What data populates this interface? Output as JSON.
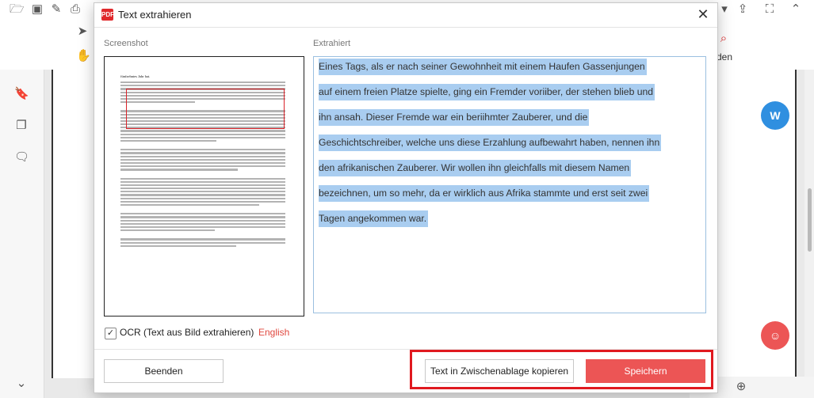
{
  "background_app": {
    "toolbar_fragment": "den",
    "fab_word_icon": "word-convert-icon",
    "fab_ai_icon": "ai-assistant-icon"
  },
  "dialog": {
    "title": "Text extrahieren",
    "close_icon": "close-icon",
    "screenshot_label": "Screenshot",
    "extracted_label": "Extrahiert",
    "screenshot_heading": "fünfzehntes Jahr hat.",
    "extracted_lines": [
      "Eines Tags, als er nach seiner Gewohnheit mit einem Haufen Gassenjungen",
      "auf einem freien Platze spielte, ging ein Fremder voriiber, der stehen blieb und",
      "ihn ansah. Dieser Fremde war ein beriihmter Zauberer, und die",
      "Geschichtschreiber, welche uns diese Erzahlung aufbewahrt haben, nennen ihn",
      "den afrikanischen Zauberer. Wir wollen ihn gleichfalls mit diesem Namen",
      "bezeichnen, um so mehr, da er wirklich aus Afrika stammte und erst seit zwei",
      "Tagen angekommen war."
    ],
    "ocr": {
      "checked": true,
      "label": "OCR (Text aus Bild extrahieren)",
      "language": "English"
    },
    "buttons": {
      "close": "Beenden",
      "copy": "Text in Zwischenablage kopieren",
      "save": "Speichern"
    },
    "colors": {
      "accent_red": "#ec5555",
      "selection_blue": "#a9cdf0",
      "annotation_red": "#e0191f"
    }
  }
}
